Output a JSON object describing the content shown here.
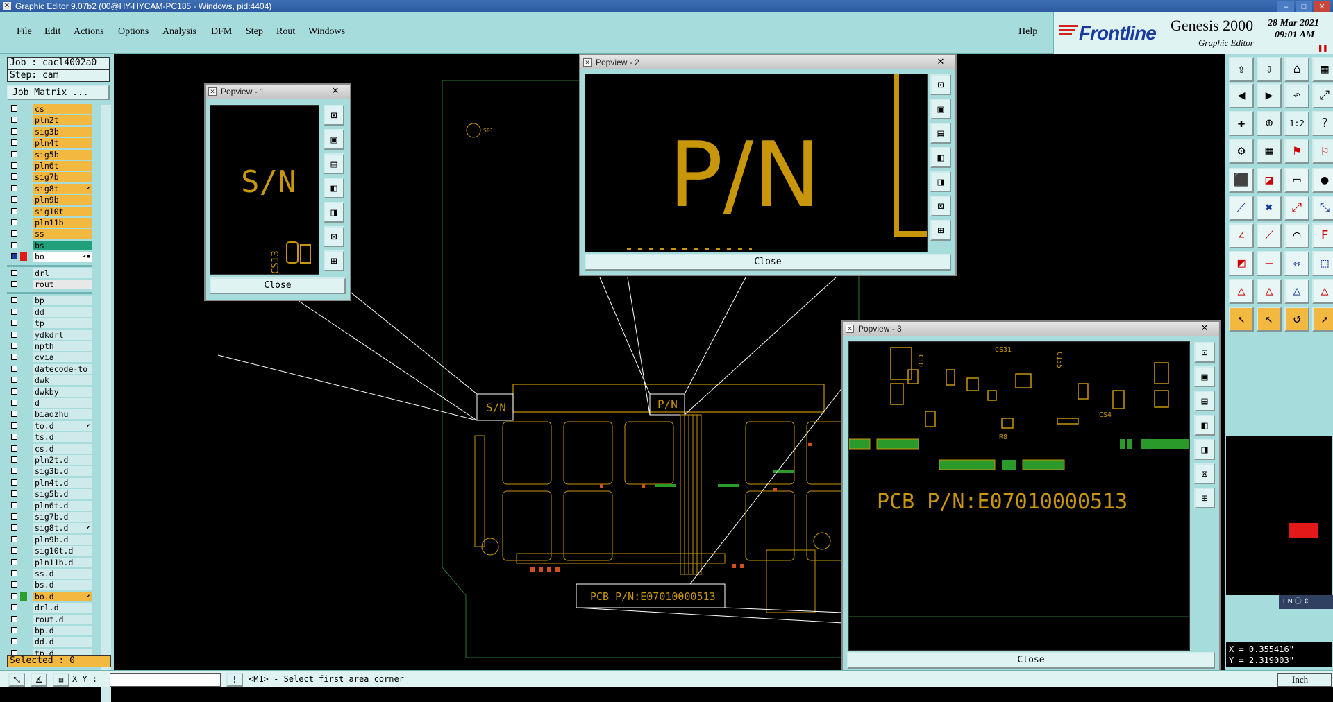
{
  "window": {
    "title": "Graphic Editor 9.07b2 (00@HY-HYCAM-PC185 - Windows, pid:4404)",
    "minimize": "–",
    "maximize": "□",
    "close": "✕"
  },
  "menu": [
    "File",
    "Edit",
    "Actions",
    "Options",
    "Analysis",
    "DFM",
    "Step",
    "Rout",
    "Windows"
  ],
  "help": "Help",
  "brand": {
    "name": "Frontline",
    "product": "Genesis 2000",
    "subtitle": "Graphic Editor",
    "date": "28 Mar 2021",
    "time": "09:01 AM"
  },
  "job": {
    "job_label": "Job : cacl4002a0",
    "step_label": "Step: cam",
    "matrix_button": "Job Matrix ..."
  },
  "layers": [
    {
      "name": "cs",
      "color": "#f3b840",
      "group": 1
    },
    {
      "name": "pln2t",
      "color": "#f3b840",
      "group": 1
    },
    {
      "name": "sig3b",
      "color": "#f3b840",
      "group": 1
    },
    {
      "name": "pln4t",
      "color": "#f3b840",
      "group": 1
    },
    {
      "name": "sig5b",
      "color": "#f3b840",
      "group": 1
    },
    {
      "name": "pln6t",
      "color": "#f3b840",
      "group": 1
    },
    {
      "name": "sig7b",
      "color": "#f3b840",
      "group": 1
    },
    {
      "name": "sig8t",
      "color": "#f3b840",
      "group": 1,
      "mark": "⬋"
    },
    {
      "name": "pln9b",
      "color": "#f3b840",
      "group": 1
    },
    {
      "name": "sig10t",
      "color": "#f3b840",
      "group": 1
    },
    {
      "name": "pln11b",
      "color": "#f3b840",
      "group": 1
    },
    {
      "name": "ss",
      "color": "#f3b840",
      "group": 1
    },
    {
      "name": "bs",
      "color": "#1fa07a",
      "group": 1
    },
    {
      "name": "bo",
      "color": "#ffffff",
      "group": 1,
      "active": true,
      "mark": "⬋▪"
    },
    {
      "name": "drl",
      "color": "#cfeaea",
      "group": 2
    },
    {
      "name": "rout",
      "color": "#e8e8e8",
      "group": 2
    },
    {
      "name": "bp",
      "color": "#cfeaea",
      "group": 3
    },
    {
      "name": "dd",
      "color": "#cfeaea",
      "group": 3
    },
    {
      "name": "tp",
      "color": "#cfeaea",
      "group": 3
    },
    {
      "name": "ydkdrl",
      "color": "#cfeaea",
      "group": 3
    },
    {
      "name": "npth",
      "color": "#cfeaea",
      "group": 3
    },
    {
      "name": "cvia",
      "color": "#cfeaea",
      "group": 3
    },
    {
      "name": "datecode-to",
      "color": "#cfeaea",
      "group": 3
    },
    {
      "name": "dwk",
      "color": "#cfeaea",
      "group": 3
    },
    {
      "name": "dwkby",
      "color": "#cfeaea",
      "group": 3
    },
    {
      "name": "d",
      "color": "#cfeaea",
      "group": 3
    },
    {
      "name": "biaozhu",
      "color": "#cfeaea",
      "group": 3
    },
    {
      "name": "to.d",
      "color": "#cfeaea",
      "group": 3,
      "mark": "⬋"
    },
    {
      "name": "ts.d",
      "color": "#cfeaea",
      "group": 3
    },
    {
      "name": "cs.d",
      "color": "#cfeaea",
      "group": 3
    },
    {
      "name": "pln2t.d",
      "color": "#cfeaea",
      "group": 3
    },
    {
      "name": "sig3b.d",
      "color": "#cfeaea",
      "group": 3
    },
    {
      "name": "pln4t.d",
      "color": "#cfeaea",
      "group": 3
    },
    {
      "name": "sig5b.d",
      "color": "#cfeaea",
      "group": 3
    },
    {
      "name": "pln6t.d",
      "color": "#cfeaea",
      "group": 3
    },
    {
      "name": "sig7b.d",
      "color": "#cfeaea",
      "group": 3
    },
    {
      "name": "sig8t.d",
      "color": "#cfeaea",
      "group": 3,
      "mark": "⬋"
    },
    {
      "name": "pln9b.d",
      "color": "#cfeaea",
      "group": 3
    },
    {
      "name": "sig10t.d",
      "color": "#cfeaea",
      "group": 3
    },
    {
      "name": "pln11b.d",
      "color": "#cfeaea",
      "group": 3
    },
    {
      "name": "ss.d",
      "color": "#cfeaea",
      "group": 3
    },
    {
      "name": "bs.d",
      "color": "#cfeaea",
      "group": 3
    },
    {
      "name": "bo.d",
      "color": "#f3b840",
      "group": 3,
      "swatch": "#2aa02a",
      "mark": "⬋"
    },
    {
      "name": "drl.d",
      "color": "#cfeaea",
      "group": 3
    },
    {
      "name": "rout.d",
      "color": "#cfeaea",
      "group": 3
    },
    {
      "name": "bp.d",
      "color": "#cfeaea",
      "group": 3
    },
    {
      "name": "dd.d",
      "color": "#cfeaea",
      "group": 3
    },
    {
      "name": "tp.d",
      "color": "#cfeaea",
      "group": 3
    }
  ],
  "selected": "Selected : 0",
  "popviews": [
    {
      "title": "Popview - 1",
      "text": "S/N",
      "close": "Close"
    },
    {
      "title": "Popview - 2",
      "text": "P/N",
      "close": "Close"
    },
    {
      "title": "Popview - 3",
      "text": "PCB P/N:E07010000513",
      "close": "Close"
    }
  ],
  "board": {
    "sn_label": "S/N",
    "pn_label": "P/N",
    "pcb_pn": "PCB P/N:E07010000513"
  },
  "coordinates": {
    "x": "X = 0.355416\"",
    "y": "Y = 2.319003\""
  },
  "language": "EN",
  "status": {
    "xy_label": "X Y :",
    "xy_value": "",
    "prompt": "<M1> - Select first area corner",
    "units": "Inch"
  },
  "colors": {
    "panel": "#a7dcdc",
    "layer_active": "#f3b840",
    "board_features": "#c8960a",
    "outline": "#2a7a2a"
  }
}
